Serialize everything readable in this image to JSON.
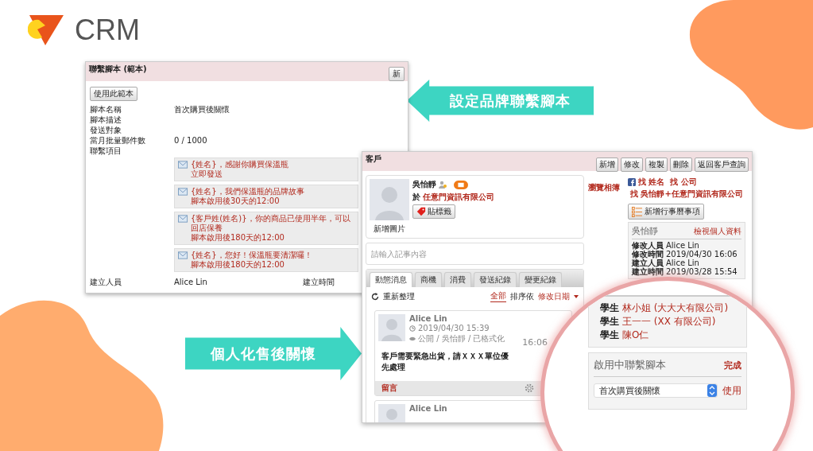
{
  "logo": {
    "text": "CRM"
  },
  "callouts": [
    {
      "kind": "left",
      "text": "設定品牌聯繫腳本"
    },
    {
      "kind": "right",
      "text": "個人化售後關懷"
    }
  ],
  "script_panel": {
    "title": "聯繫腳本 (範本)",
    "header_button": "新",
    "use_button": "使用此範本",
    "fields": [
      {
        "label": "腳本名稱",
        "value": "首次購買後關懷"
      },
      {
        "label": "腳本描述"
      },
      {
        "label": "發送對象"
      },
      {
        "label": "當月批量郵件數",
        "value": "0 / 1000"
      },
      {
        "label": "聯繫項目"
      }
    ],
    "items": [
      {
        "subject": "{姓名}，感謝你購買保溫瓶",
        "timing": "立即發送"
      },
      {
        "subject": "{姓名}，我們保溫瓶的品牌故事",
        "timing": "腳本啟用後30天的12:00"
      },
      {
        "subject": "{客戶姓(姓名)}，你的商品已使用半年，可以回店保養",
        "timing": "腳本啟用後180天的12:00"
      },
      {
        "subject": "{姓名}，您好！保溫瓶要清潔囉！",
        "timing": "腳本啟用後180天的12:00"
      }
    ],
    "creator_label": "建立人員",
    "creator": "Alice Lin",
    "created_label": "建立時間"
  },
  "customer_panel": {
    "title": "客戶",
    "buttons": [
      "新增",
      "修改",
      "複製",
      "刪除",
      "返回客戶查詢"
    ],
    "profile": {
      "name": "吳怡靜",
      "company_prefix": "於",
      "company": "任意門資訊有限公司",
      "tag_button": "貼標籤",
      "photo_caption": "新增圖片",
      "album_link": "瀏覽相簿"
    },
    "note_placeholder": "請輸入記事內容",
    "tabs": [
      {
        "label": "動態消息",
        "selected": true
      },
      {
        "label": "商機",
        "selected": false
      },
      {
        "label": "消費",
        "selected": false
      },
      {
        "label": "發送紀錄",
        "selected": false
      },
      {
        "label": "變更紀錄",
        "selected": false
      }
    ],
    "feed_toolbar": {
      "refresh": "重新整理",
      "filter": "全部",
      "sort_label": "排序依",
      "sort_value": "修改日期"
    },
    "posts": [
      {
        "author": "Alice Lin",
        "time": "2019/04/30 15:39",
        "meta": "公開 / 吳怡靜 / 已格式化",
        "body": "客戶需要緊急出貨，請ＸＸＸ單位優先處理",
        "stamp": "16:06",
        "comment": "留言"
      },
      {
        "author": "Alice Lin"
      }
    ],
    "search_links": [
      {
        "kind": "facebook",
        "parts": [
          "找 姓名",
          "找 公司"
        ]
      },
      {
        "kind": "google",
        "parts": [
          "找 吳怡靜+任意門資訊有限公司"
        ]
      }
    ],
    "calendar_button": "新增行事曆事項",
    "info": {
      "name": "吳怡靜",
      "link": "檢視個人資料",
      "rows": [
        {
          "label": "修改人員",
          "value": "Alice Lin"
        },
        {
          "label": "修改時間",
          "value": "2019/04/30 16:06"
        },
        {
          "label": "建立人員",
          "value": "Alice Lin"
        },
        {
          "label": "建立時間",
          "value": "2019/03/28 15:54"
        }
      ]
    }
  },
  "magnifier": {
    "relations": [
      {
        "role": "學生",
        "name": "林小姐 (大大大有限公司)"
      },
      {
        "role": "學生",
        "name": "王一一 (XX 有限公司)"
      },
      {
        "role": "學生",
        "name": "陳O仁"
      }
    ],
    "script_box": {
      "title": "啟用中聯繫腳本",
      "done": "完成",
      "selected": "首次購買後關懷",
      "use": "使用"
    }
  }
}
